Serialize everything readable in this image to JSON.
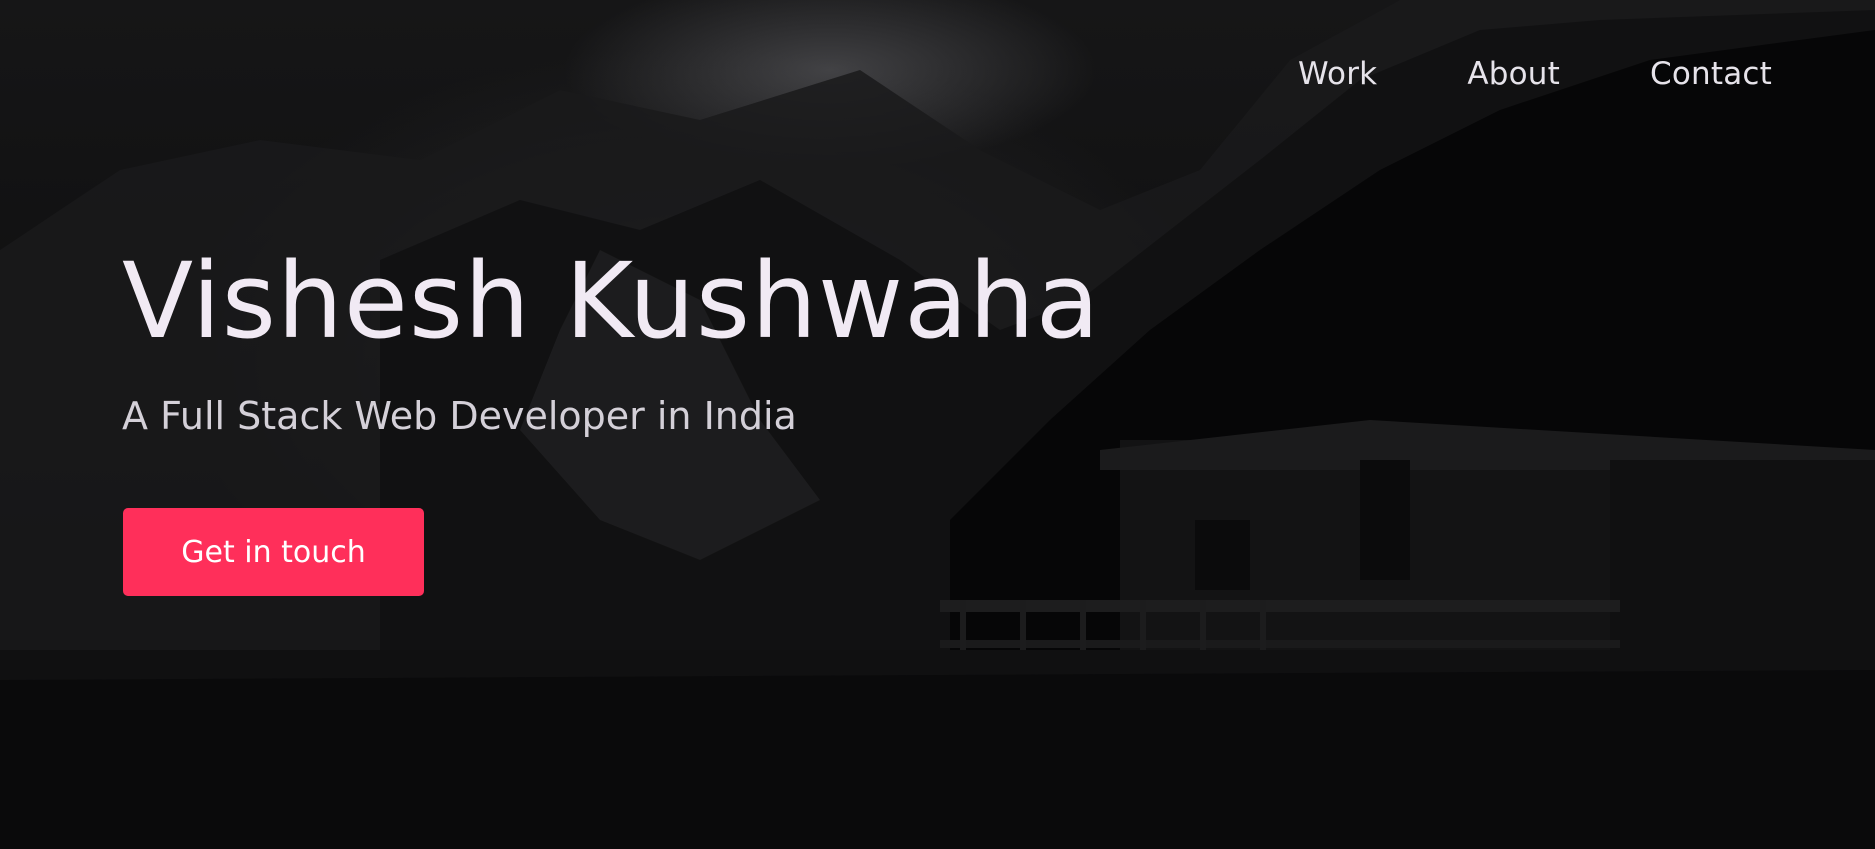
{
  "nav": {
    "items": [
      {
        "label": "Work"
      },
      {
        "label": "About"
      },
      {
        "label": "Contact"
      }
    ]
  },
  "hero": {
    "title": "Vishesh Kushwaha",
    "subtitle": "A Full Stack Web Developer in India",
    "cta_label": "Get in touch"
  },
  "colors": {
    "accent": "#ff2f5a",
    "background": "#0b0b0c",
    "text": "#f1eaf4"
  }
}
